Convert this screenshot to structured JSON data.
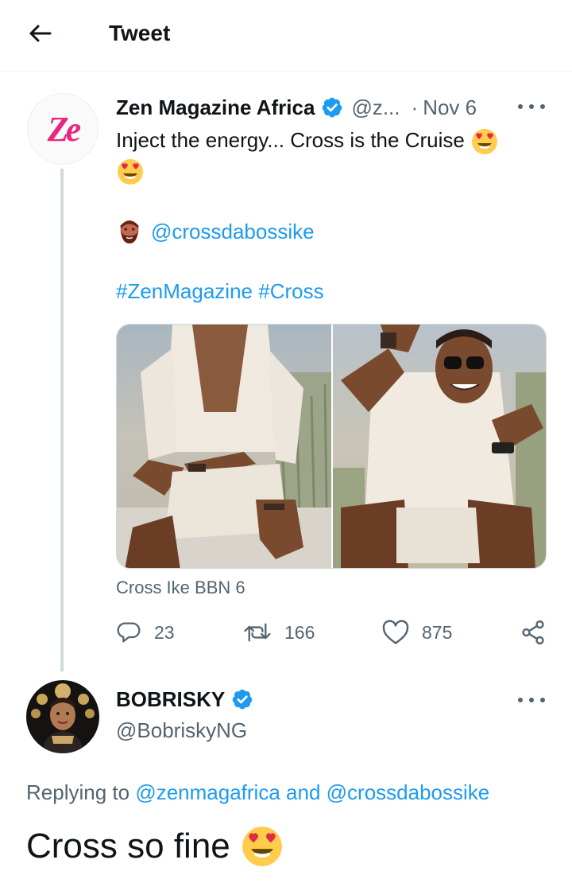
{
  "header": {
    "title": "Tweet"
  },
  "tweet1": {
    "author_name": "Zen Magazine Africa",
    "handle": "@z...",
    "separator": "·",
    "date": "Nov 6",
    "text": "Inject the energy... Cross is the Cruise",
    "mention": "@crossdabossike",
    "hashtags": [
      "#ZenMagazine",
      "#Cross"
    ],
    "caption": "Cross Ike BBN 6",
    "stats": {
      "replies": "23",
      "retweets": "166",
      "likes": "875"
    },
    "avatar_logo": "Ze"
  },
  "tweet2": {
    "author_name": "BOBRISKY",
    "handle": "@BobriskyNG",
    "replying_prefix": "Replying to",
    "replying_to_1": "@zenmagafrica",
    "replying_and": "and",
    "replying_to_2": "@crossdabossike",
    "text": "Cross so fine"
  },
  "icons": {
    "back": "arrow-left-icon",
    "verified": "verified-badge-icon",
    "more": "more-dots-icon",
    "reply": "reply-icon",
    "retweet": "retweet-icon",
    "like": "heart-icon",
    "share": "share-icon",
    "emoji_heart_eyes": "heart-eyes-emoji",
    "emoji_man": "bearded-man-emoji"
  },
  "colors": {
    "link": "#1d9bf0",
    "verified": "#1d9bf0",
    "secondary_text": "#536471",
    "brand_pink": "#e8287e"
  }
}
